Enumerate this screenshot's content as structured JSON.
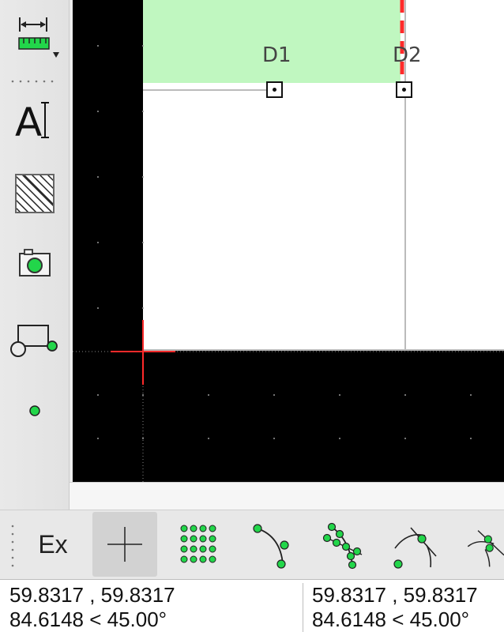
{
  "left_toolbar": {
    "tools": [
      {
        "name": "dimension-tool",
        "icon": "ruler-dimension-icon"
      },
      {
        "name": "text-tool",
        "icon": "text-cursor-icon",
        "label": "A"
      },
      {
        "name": "hatch-tool",
        "icon": "hatch-pattern-icon"
      },
      {
        "name": "image-tool",
        "icon": "camera-icon"
      },
      {
        "name": "block-tool",
        "icon": "block-insert-icon"
      },
      {
        "name": "point-tool",
        "icon": "point-icon"
      }
    ]
  },
  "drawing": {
    "labels": [
      "D1",
      "D2"
    ],
    "colors": {
      "background": "#000000",
      "highlight_fill": "#c0f7c0",
      "paper": "#ffffff",
      "crosshair": "#ff2a2a",
      "dashed_line": "#ff2a2a",
      "grid_dot": "#9a9a9a"
    }
  },
  "snap_toolbar": {
    "ex_label": "Ex",
    "items": [
      {
        "name": "snap-exclusive",
        "label": "Ex",
        "active": false
      },
      {
        "name": "snap-free",
        "icon": "crosshair-icon",
        "active": true
      },
      {
        "name": "snap-grid",
        "icon": "grid-points-icon",
        "active": false
      },
      {
        "name": "snap-endpoints",
        "icon": "endpoints-icon",
        "active": false
      },
      {
        "name": "snap-on-entity",
        "icon": "on-entity-icon",
        "active": false
      },
      {
        "name": "snap-center",
        "icon": "center-icon",
        "active": false
      },
      {
        "name": "snap-intersection",
        "icon": "intersection-icon",
        "active": false
      }
    ]
  },
  "status": {
    "absolute": {
      "cartesian": "59.8317 , 59.8317",
      "polar": "84.6148 < 45.00°"
    },
    "relative": {
      "cartesian": "59.8317 , 59.8317",
      "polar": "84.6148 < 45.00°"
    }
  }
}
